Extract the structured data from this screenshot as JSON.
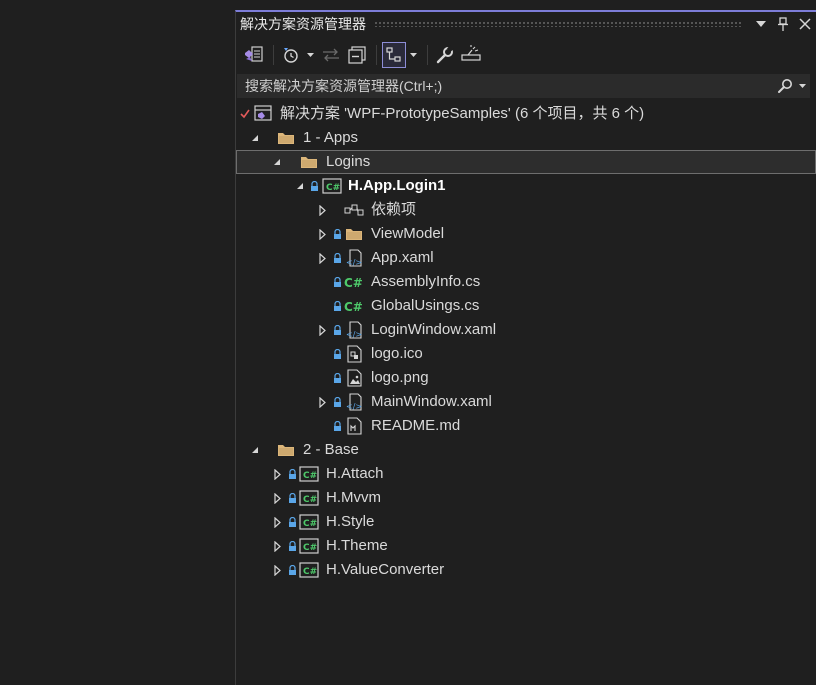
{
  "panel": {
    "title": "解决方案资源管理器",
    "title_buttons": [
      "chevron-down-icon",
      "pin-icon",
      "close-icon"
    ]
  },
  "toolbar": {
    "buttons": [
      "vs-solution-switch-icon",
      "history-icon",
      "sync-arrows-icon",
      "collapse-all-icon",
      "show-all-files-icon",
      "properties-wrench-icon",
      "preview-selected-icon"
    ]
  },
  "search": {
    "placeholder": "搜索解决方案资源管理器(Ctrl+;)"
  },
  "tree": {
    "solution": {
      "label": "解决方案 'WPF-PrototypeSamples' (6 个项目，共 6 个)"
    },
    "folder_apps": {
      "label": "1 - Apps"
    },
    "folder_logins": {
      "label": "Logins"
    },
    "project_login": {
      "label": "H.App.Login1"
    },
    "dependencies": {
      "label": "依赖项"
    },
    "viewmodel": {
      "label": "ViewModel"
    },
    "app_xaml": {
      "label": "App.xaml"
    },
    "assemblyinfo": {
      "label": "AssemblyInfo.cs"
    },
    "globalusings": {
      "label": "GlobalUsings.cs"
    },
    "loginwindow": {
      "label": "LoginWindow.xaml"
    },
    "logo_ico": {
      "label": "logo.ico"
    },
    "logo_png": {
      "label": "logo.png"
    },
    "mainwindow": {
      "label": "MainWindow.xaml"
    },
    "readme": {
      "label": "README.md"
    },
    "folder_base": {
      "label": "2 - Base"
    },
    "attach": {
      "label": "H.Attach"
    },
    "mvvm": {
      "label": "H.Mvvm"
    },
    "style": {
      "label": "H.Style"
    },
    "theme": {
      "label": "H.Theme"
    },
    "valueconverter": {
      "label": "H.ValueConverter"
    }
  },
  "colors": {
    "accent": "#7d7dd8",
    "background": "#1f1f1f",
    "folder": "#dcb67a",
    "csharp": "#4ec96a",
    "lock": "#5aa6e8"
  }
}
